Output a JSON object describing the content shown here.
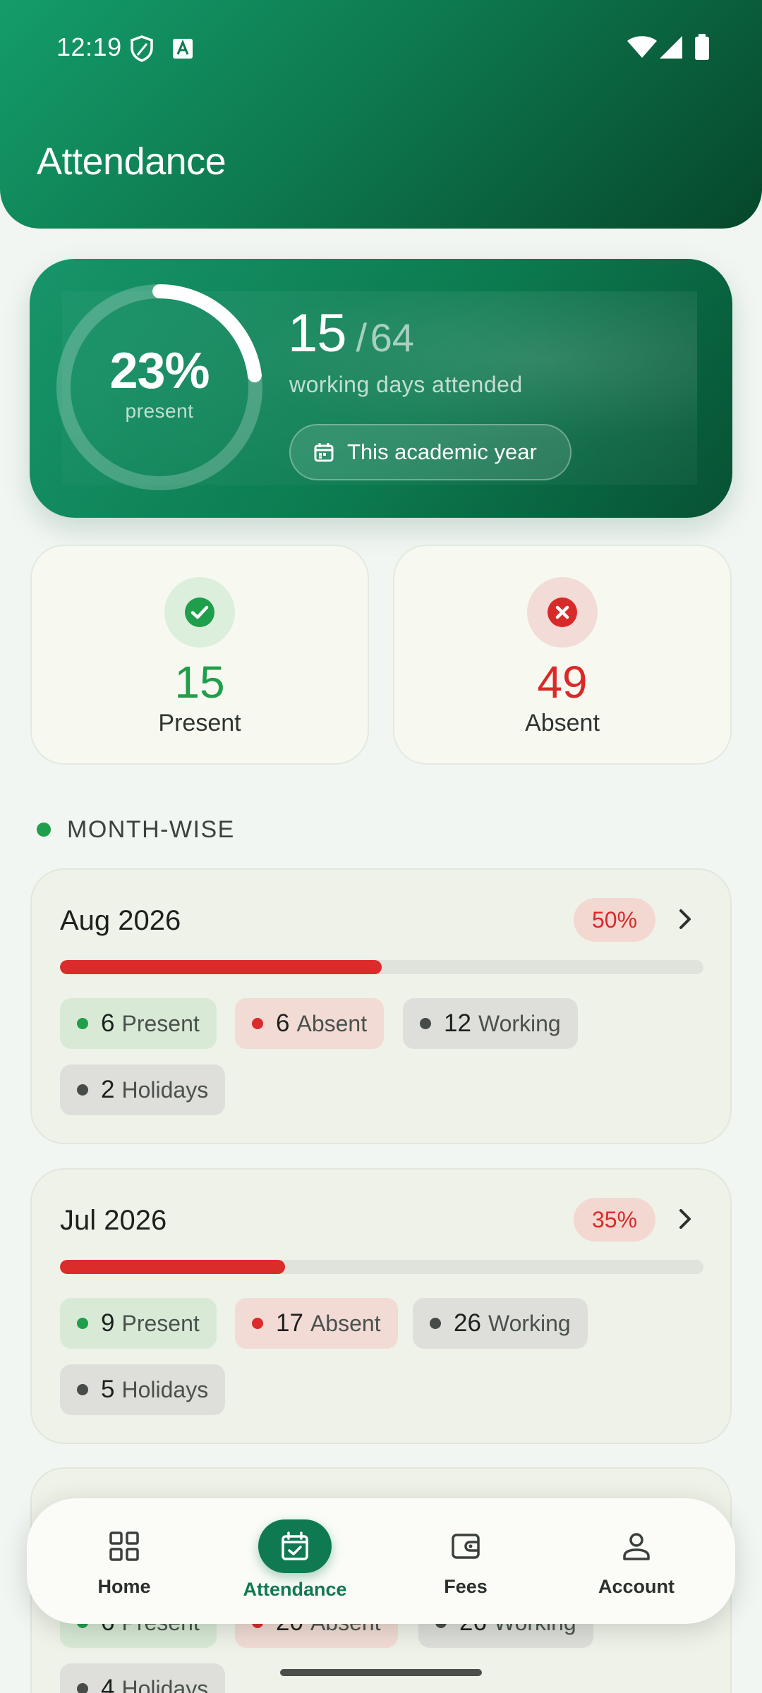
{
  "status_bar": {
    "time": "12:19",
    "icons": [
      "shield-icon",
      "text-a-icon",
      "wifi-icon",
      "signal-icon",
      "battery-icon"
    ]
  },
  "header": {
    "title": "Attendance"
  },
  "summary": {
    "percent_label": "23%",
    "percent_value": 0.23,
    "percent_caption": "present",
    "attended": "15",
    "separator": "/",
    "total": "64",
    "description": "working days attended",
    "period_chip": "This academic year"
  },
  "stats": {
    "present": {
      "value": "15",
      "label": "Present"
    },
    "absent": {
      "value": "49",
      "label": "Absent"
    }
  },
  "section": {
    "title": "MONTH-WISE"
  },
  "months": [
    {
      "title": "Aug 2026",
      "badge": "50%",
      "progress": 0.5,
      "present_num": "6",
      "present_label": "Present",
      "absent_num": "6",
      "absent_label": "Absent",
      "working_num": "12",
      "working_label": "Working",
      "holidays_num": "2",
      "holidays_label": "Holidays"
    },
    {
      "title": "Jul 2026",
      "badge": "35%",
      "progress": 0.35,
      "present_num": "9",
      "present_label": "Present",
      "absent_num": "17",
      "absent_label": "Absent",
      "working_num": "26",
      "working_label": "Working",
      "holidays_num": "5",
      "holidays_label": "Holidays"
    },
    {
      "title": "",
      "badge": "",
      "progress": 0,
      "present_num": "6",
      "present_label": "Present",
      "absent_num": "20",
      "absent_label": "Absent",
      "working_num": "26",
      "working_label": "Working",
      "holidays_num": "4",
      "holidays_label": "Holidays"
    }
  ],
  "nav": {
    "items": [
      {
        "label": "Home",
        "icon": "grid-icon"
      },
      {
        "label": "Attendance",
        "icon": "calendar-check-icon",
        "active": true
      },
      {
        "label": "Fees",
        "icon": "wallet-icon"
      },
      {
        "label": "Account",
        "icon": "person-icon"
      }
    ]
  },
  "colors": {
    "brand": "#0f7a52",
    "present": "#1f9e4b",
    "absent": "#dc2b2b"
  }
}
